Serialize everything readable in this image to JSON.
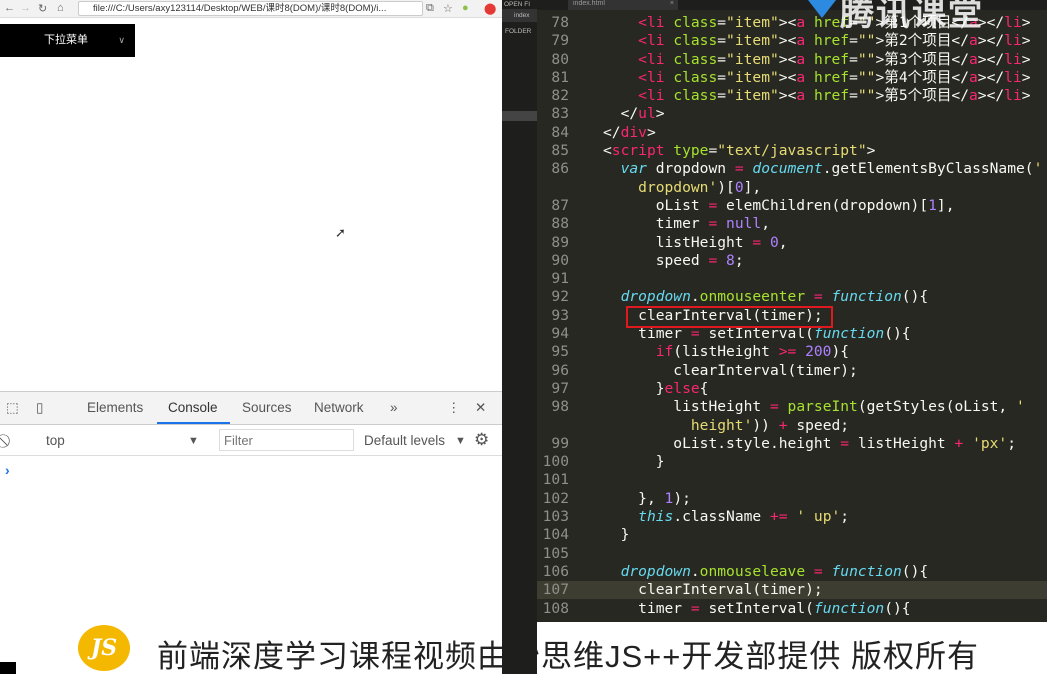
{
  "browser": {
    "back_icon": "arrow-left",
    "url": "file:///C:/Users/axy123114/Desktop/WEB/课时8(DOM)/课时8(DOM)/i...",
    "dropdown_label": "下拉菜单",
    "dropdown_chevron": "∨"
  },
  "devtools": {
    "tabs": [
      "Elements",
      "Console",
      "Sources",
      "Network",
      "»"
    ],
    "active_tab": "Console",
    "context": "top",
    "filter_placeholder": "Filter",
    "levels": "Default levels",
    "prompt": "›"
  },
  "editor": {
    "tab_title": "index.html",
    "sidebar_open_files": "OPEN FI",
    "sidebar_file": "index",
    "sidebar_folders": "FOLDER",
    "watermark": "腾讯课堂",
    "lines": [
      {
        "n": "78",
        "i": 4,
        "t": [
          [
            "tag",
            "<"
          ],
          [
            "tag",
            "li"
          ],
          [
            "attr",
            " class"
          ],
          [
            "pl",
            "="
          ],
          [
            "str",
            "\"item\""
          ],
          [
            "pl",
            ">"
          ],
          [
            "pl",
            "<"
          ],
          [
            "tag",
            "a"
          ],
          [
            "attr",
            " href"
          ],
          [
            "pl",
            "="
          ],
          [
            "str",
            "\"\""
          ],
          [
            "pl",
            ">第1个项目</"
          ],
          [
            "tag",
            "a"
          ],
          [
            "pl",
            "></"
          ],
          [
            "tag",
            "li"
          ],
          [
            "pl",
            ">"
          ]
        ]
      },
      {
        "n": "79",
        "i": 4,
        "t": [
          [
            "tag",
            "<"
          ],
          [
            "tag",
            "li"
          ],
          [
            "attr",
            " class"
          ],
          [
            "pl",
            "="
          ],
          [
            "str",
            "\"item\""
          ],
          [
            "pl",
            ">"
          ],
          [
            "pl",
            "<"
          ],
          [
            "tag",
            "a"
          ],
          [
            "attr",
            " href"
          ],
          [
            "pl",
            "="
          ],
          [
            "str",
            "\"\""
          ],
          [
            "pl",
            ">第2个项目</"
          ],
          [
            "tag",
            "a"
          ],
          [
            "pl",
            "></"
          ],
          [
            "tag",
            "li"
          ],
          [
            "pl",
            ">"
          ]
        ]
      },
      {
        "n": "80",
        "i": 4,
        "t": [
          [
            "tag",
            "<"
          ],
          [
            "tag",
            "li"
          ],
          [
            "attr",
            " class"
          ],
          [
            "pl",
            "="
          ],
          [
            "str",
            "\"item\""
          ],
          [
            "pl",
            ">"
          ],
          [
            "pl",
            "<"
          ],
          [
            "tag",
            "a"
          ],
          [
            "attr",
            " href"
          ],
          [
            "pl",
            "="
          ],
          [
            "str",
            "\"\""
          ],
          [
            "pl",
            ">第3个项目</"
          ],
          [
            "tag",
            "a"
          ],
          [
            "pl",
            "></"
          ],
          [
            "tag",
            "li"
          ],
          [
            "pl",
            ">"
          ]
        ]
      },
      {
        "n": "81",
        "i": 4,
        "t": [
          [
            "tag",
            "<"
          ],
          [
            "tag",
            "li"
          ],
          [
            "attr",
            " class"
          ],
          [
            "pl",
            "="
          ],
          [
            "str",
            "\"item\""
          ],
          [
            "pl",
            ">"
          ],
          [
            "pl",
            "<"
          ],
          [
            "tag",
            "a"
          ],
          [
            "attr",
            " href"
          ],
          [
            "pl",
            "="
          ],
          [
            "str",
            "\"\""
          ],
          [
            "pl",
            ">第4个项目</"
          ],
          [
            "tag",
            "a"
          ],
          [
            "pl",
            "></"
          ],
          [
            "tag",
            "li"
          ],
          [
            "pl",
            ">"
          ]
        ]
      },
      {
        "n": "82",
        "i": 4,
        "t": [
          [
            "tag",
            "<"
          ],
          [
            "tag",
            "li"
          ],
          [
            "attr",
            " class"
          ],
          [
            "pl",
            "="
          ],
          [
            "str",
            "\"item\""
          ],
          [
            "pl",
            ">"
          ],
          [
            "pl",
            "<"
          ],
          [
            "tag",
            "a"
          ],
          [
            "attr",
            " href"
          ],
          [
            "pl",
            "="
          ],
          [
            "str",
            "\"\""
          ],
          [
            "pl",
            ">第5个项目</"
          ],
          [
            "tag",
            "a"
          ],
          [
            "pl",
            "></"
          ],
          [
            "tag",
            "li"
          ],
          [
            "pl",
            ">"
          ]
        ]
      },
      {
        "n": "83",
        "i": 2,
        "t": [
          [
            "pl",
            "</"
          ],
          [
            "tag",
            "ul"
          ],
          [
            "pl",
            ">"
          ]
        ]
      },
      {
        "n": "84",
        "i": 0,
        "t": [
          [
            "pl",
            "</"
          ],
          [
            "tag",
            "div"
          ],
          [
            "pl",
            ">"
          ]
        ]
      },
      {
        "n": "85",
        "i": 0,
        "t": [
          [
            "pl",
            "<"
          ],
          [
            "tag",
            "script"
          ],
          [
            "attr",
            " type"
          ],
          [
            "pl",
            "="
          ],
          [
            "str",
            "\"text/javascript\""
          ],
          [
            "pl",
            ">"
          ]
        ]
      },
      {
        "n": "86",
        "i": 2,
        "t": [
          [
            "kw",
            "var"
          ],
          [
            "pl",
            " dropdown "
          ],
          [
            "op",
            "="
          ],
          [
            "pl",
            " "
          ],
          [
            "kw",
            "document"
          ],
          [
            "pl",
            ".getElementsByClassName("
          ],
          [
            "str",
            "'"
          ]
        ]
      },
      {
        "n": "",
        "i": 4,
        "t": [
          [
            "str",
            "dropdown'"
          ],
          [
            "pl",
            ")["
          ],
          [
            "num",
            "0"
          ],
          [
            "pl",
            "],"
          ]
        ]
      },
      {
        "n": "87",
        "i": 6,
        "t": [
          [
            "pl",
            "oList "
          ],
          [
            "op",
            "="
          ],
          [
            "pl",
            " elemChildren(dropdown)["
          ],
          [
            "num",
            "1"
          ],
          [
            "pl",
            "],"
          ]
        ]
      },
      {
        "n": "88",
        "i": 6,
        "t": [
          [
            "pl",
            "timer "
          ],
          [
            "op",
            "="
          ],
          [
            "pl",
            " "
          ],
          [
            "num",
            "null"
          ],
          [
            "pl",
            ","
          ]
        ]
      },
      {
        "n": "89",
        "i": 6,
        "t": [
          [
            "pl",
            "listHeight "
          ],
          [
            "op",
            "="
          ],
          [
            "pl",
            " "
          ],
          [
            "num",
            "0"
          ],
          [
            "pl",
            ","
          ]
        ]
      },
      {
        "n": "90",
        "i": 6,
        "t": [
          [
            "pl",
            "speed "
          ],
          [
            "op",
            "="
          ],
          [
            "pl",
            " "
          ],
          [
            "num",
            "8"
          ],
          [
            "pl",
            ";"
          ]
        ]
      },
      {
        "n": "91",
        "i": 0,
        "t": []
      },
      {
        "n": "92",
        "i": 2,
        "t": [
          [
            "kw",
            "dropdown"
          ],
          [
            "pl",
            "."
          ],
          [
            "fn",
            "onmouseenter"
          ],
          [
            "pl",
            " "
          ],
          [
            "op",
            "="
          ],
          [
            "pl",
            " "
          ],
          [
            "kw",
            "function"
          ],
          [
            "pl",
            "(){"
          ]
        ]
      },
      {
        "n": "93",
        "i": 4,
        "t": [
          [
            "pl",
            "clearInterval(timer);"
          ]
        ]
      },
      {
        "n": "94",
        "i": 4,
        "t": [
          [
            "pl",
            "timer "
          ],
          [
            "op",
            "="
          ],
          [
            "pl",
            " setInterval("
          ],
          [
            "kw",
            "function"
          ],
          [
            "pl",
            "(){"
          ]
        ]
      },
      {
        "n": "95",
        "i": 6,
        "t": [
          [
            "tag",
            "if"
          ],
          [
            "pl",
            "(listHeight "
          ],
          [
            "op",
            ">="
          ],
          [
            "pl",
            " "
          ],
          [
            "num",
            "200"
          ],
          [
            "pl",
            "){"
          ]
        ]
      },
      {
        "n": "96",
        "i": 8,
        "t": [
          [
            "pl",
            "clearInterval(timer);"
          ]
        ]
      },
      {
        "n": "97",
        "i": 6,
        "t": [
          [
            "pl",
            "}"
          ],
          [
            "tag",
            "else"
          ],
          [
            "pl",
            "{"
          ]
        ]
      },
      {
        "n": "98",
        "i": 8,
        "t": [
          [
            "pl",
            "listHeight "
          ],
          [
            "op",
            "="
          ],
          [
            "pl",
            " "
          ],
          [
            "fn",
            "parseInt"
          ],
          [
            "pl",
            "(getStyles(oList, "
          ],
          [
            "str",
            "'"
          ]
        ]
      },
      {
        "n": "",
        "i": 10,
        "t": [
          [
            "str",
            "height'"
          ],
          [
            "pl",
            ")) "
          ],
          [
            "op",
            "+"
          ],
          [
            "pl",
            " speed;"
          ]
        ]
      },
      {
        "n": "99",
        "i": 8,
        "t": [
          [
            "pl",
            "oList.style.height "
          ],
          [
            "op",
            "="
          ],
          [
            "pl",
            " listHeight "
          ],
          [
            "op",
            "+"
          ],
          [
            "pl",
            " "
          ],
          [
            "str",
            "'px'"
          ],
          [
            "pl",
            ";"
          ]
        ]
      },
      {
        "n": "100",
        "i": 6,
        "t": [
          [
            "pl",
            "}"
          ]
        ]
      },
      {
        "n": "101",
        "i": 0,
        "t": []
      },
      {
        "n": "102",
        "i": 4,
        "t": [
          [
            "pl",
            "}, "
          ],
          [
            "num",
            "1"
          ],
          [
            "pl",
            ");"
          ]
        ]
      },
      {
        "n": "103",
        "i": 4,
        "t": [
          [
            "kw",
            "this"
          ],
          [
            "pl",
            ".className "
          ],
          [
            "op",
            "+="
          ],
          [
            "pl",
            " "
          ],
          [
            "str",
            "' up'"
          ],
          [
            "pl",
            ";"
          ]
        ]
      },
      {
        "n": "104",
        "i": 2,
        "t": [
          [
            "pl",
            "}"
          ]
        ]
      },
      {
        "n": "105",
        "i": 0,
        "t": []
      },
      {
        "n": "106",
        "i": 2,
        "t": [
          [
            "kw",
            "dropdown"
          ],
          [
            "pl",
            "."
          ],
          [
            "fn",
            "onmouseleave"
          ],
          [
            "pl",
            " "
          ],
          [
            "op",
            "="
          ],
          [
            "pl",
            " "
          ],
          [
            "kw",
            "function"
          ],
          [
            "pl",
            "(){"
          ]
        ]
      },
      {
        "n": "107",
        "i": 4,
        "t": [
          [
            "pl",
            "clearInterval(timer);"
          ]
        ]
      },
      {
        "n": "108",
        "i": 4,
        "t": [
          [
            "pl",
            "timer "
          ],
          [
            "op",
            "="
          ],
          [
            "pl",
            " setInterval("
          ],
          [
            "kw",
            "function"
          ],
          [
            "pl",
            "(){"
          ]
        ]
      }
    ]
  },
  "banner": {
    "logo_text": "JS",
    "text": "前端深度学习课程视频由妙思维JS++开发部提供  版权所有"
  },
  "colors": {
    "highlight_box": "#e0191e",
    "editor_bg": "#272822",
    "accent": "#1a73e8"
  }
}
